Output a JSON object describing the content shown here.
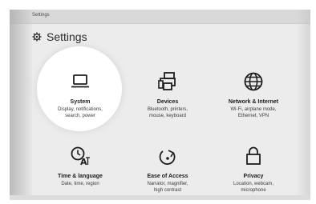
{
  "window": {
    "title": "Settings"
  },
  "header": {
    "title": "Settings",
    "icon": "gear-icon"
  },
  "tiles": [
    {
      "title": "System",
      "desc": [
        "Display, notifications,",
        "search, power"
      ],
      "icon": "laptop-icon",
      "highlighted": true
    },
    {
      "title": "Devices",
      "desc": [
        "Bluetooth, printers,",
        "mouse, keyboard"
      ],
      "icon": "printer-icon"
    },
    {
      "title": "Network & Internet",
      "desc": [
        "Wi-Fi, airplane mode,",
        "Ethernet, VPN"
      ],
      "icon": "globe-icon"
    },
    {
      "title": "Time & language",
      "desc": [
        "Date, time, region"
      ],
      "icon": "time-language-icon"
    },
    {
      "title": "Ease of Access",
      "desc": [
        "Narrator, magnifier,",
        "high contrast"
      ],
      "icon": "ease-of-access-icon"
    },
    {
      "title": "Privacy",
      "desc": [
        "Location, webcam,",
        "microphone"
      ],
      "icon": "lock-icon"
    }
  ],
  "colors": {
    "background": "#ececec",
    "spotlight": "#ffffff",
    "text": "#1b1b1b"
  }
}
